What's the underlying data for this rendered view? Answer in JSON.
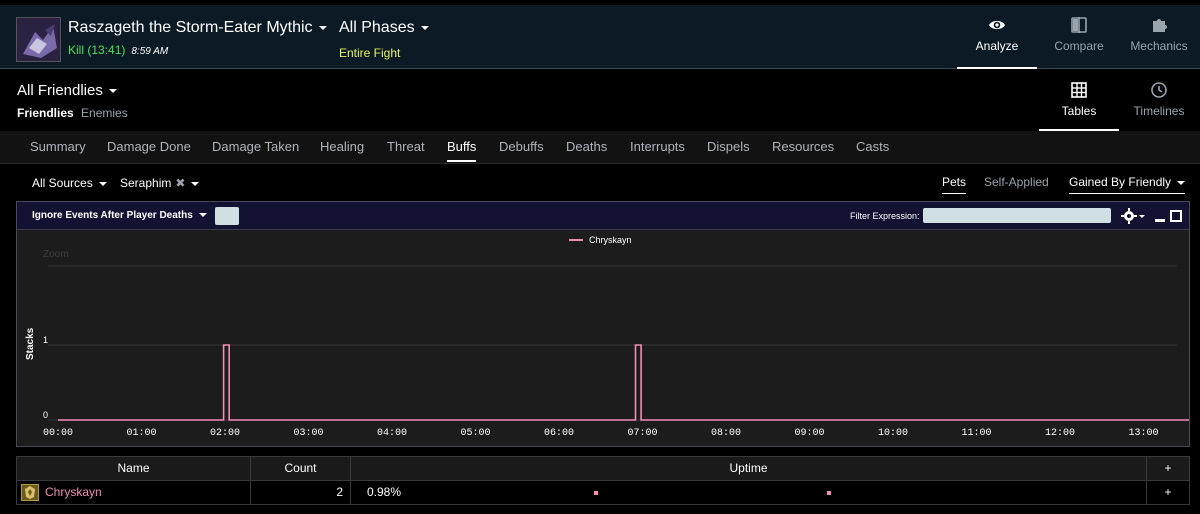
{
  "header": {
    "encounter": "Raszageth the Storm-Eater Mythic",
    "kill_label": "Kill (13:41)",
    "kill_time": "8:59 AM",
    "phase": "All Phases",
    "phase_sub": "Entire Fight",
    "nav": [
      {
        "label": "Analyze",
        "icon": "eye-icon",
        "active": true
      },
      {
        "label": "Compare",
        "icon": "compare-icon",
        "active": false
      },
      {
        "label": "Mechanics",
        "icon": "puzzle-icon",
        "active": false
      }
    ]
  },
  "subheader": {
    "title": "All Friendlies",
    "friendlies": "Friendlies",
    "enemies": "Enemies",
    "views": [
      {
        "label": "Tables",
        "icon": "grid-icon",
        "active": true
      },
      {
        "label": "Timelines",
        "icon": "clock-icon",
        "active": false
      }
    ]
  },
  "tabs": [
    "Summary",
    "Damage Done",
    "Damage Taken",
    "Healing",
    "Threat",
    "Buffs",
    "Debuffs",
    "Deaths",
    "Interrupts",
    "Dispels",
    "Resources",
    "Casts"
  ],
  "active_tab": "Buffs",
  "filters": {
    "source": "All Sources",
    "ability": "Seraphim",
    "pets": "Pets",
    "self_applied": "Self-Applied",
    "gained_by": "Gained By Friendly"
  },
  "panel": {
    "ignore_label": "Ignore Events After Player Deaths",
    "filter_expression_label": "Filter Expression:",
    "filter_expression_value": ""
  },
  "chart_data": {
    "type": "line",
    "title": "",
    "xlabel": "",
    "ylabel": "Stacks",
    "zoom_label": "Zoom",
    "x_ticks": [
      "00:00",
      "01:00",
      "02:00",
      "03:00",
      "04:00",
      "05:00",
      "06:00",
      "07:00",
      "08:00",
      "09:00",
      "10:00",
      "11:00",
      "12:00",
      "13:00"
    ],
    "y_ticks": [
      0,
      1
    ],
    "ylim": [
      0,
      1
    ],
    "xlim_seconds": [
      0,
      821
    ],
    "legend_position": "top-center",
    "series": [
      {
        "name": "Chryskayn",
        "color": "#f48cba",
        "points": [
          {
            "t": "00:00",
            "stacks": 0
          },
          {
            "t": "01:59",
            "stacks": 0
          },
          {
            "t": "01:59",
            "stacks": 1
          },
          {
            "t": "02:03",
            "stacks": 1
          },
          {
            "t": "02:03",
            "stacks": 0
          },
          {
            "t": "06:55",
            "stacks": 0
          },
          {
            "t": "06:55",
            "stacks": 1
          },
          {
            "t": "06:59",
            "stacks": 1
          },
          {
            "t": "06:59",
            "stacks": 0
          },
          {
            "t": "13:41",
            "stacks": 0
          }
        ]
      }
    ]
  },
  "table": {
    "headers": {
      "name": "Name",
      "count": "Count",
      "uptime": "Uptime",
      "plus": "+"
    },
    "rows": [
      {
        "name": "Chryskayn",
        "count": "2",
        "uptime": "0.98%",
        "plus": "+",
        "color": "#f48cba"
      }
    ]
  }
}
